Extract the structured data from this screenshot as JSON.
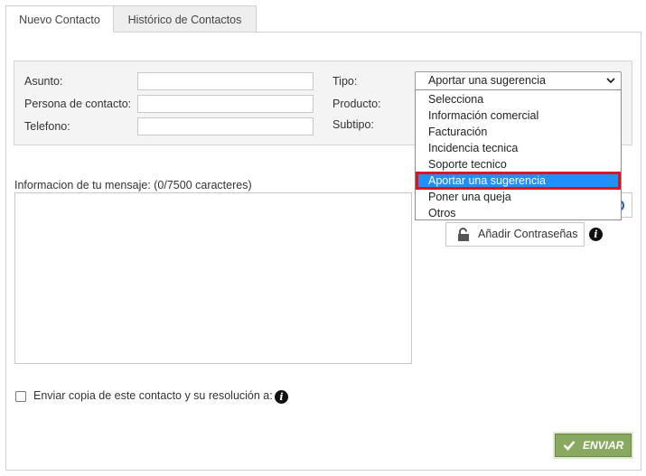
{
  "tabs": [
    {
      "label": "Nuevo Contacto",
      "active": true
    },
    {
      "label": "Histórico de Contactos",
      "active": false
    }
  ],
  "form": {
    "asunto_label": "Asunto:",
    "persona_label": "Persona de contacto:",
    "telefono_label": "Telefono:",
    "tipo_label": "Tipo:",
    "producto_label": "Producto:",
    "subtipo_label": "Subtipo:",
    "asunto_value": "",
    "persona_value": "",
    "telefono_value": ""
  },
  "tipo_select": {
    "selected": "Aportar una sugerencia",
    "options": [
      "Selecciona",
      "Información comercial",
      "Facturación",
      "Incidencia tecnica",
      "Soporte tecnico",
      "Aportar una sugerencia",
      "Poner una queja",
      "Otros"
    ],
    "highlighted_index": 5
  },
  "message": {
    "label": "Informacion de tu mensaje: (0/7500 caracteres)",
    "value": ""
  },
  "passwords_button": "Añadir Contraseñas",
  "copy_checkbox": {
    "label": "Enviar copia de este contacto y su resolución a:",
    "checked": false
  },
  "send_button": "ENVIAR",
  "colors": {
    "highlight": "#1e90ff",
    "highlight_border": "#e0121c",
    "send_bg": "#8aa960"
  }
}
